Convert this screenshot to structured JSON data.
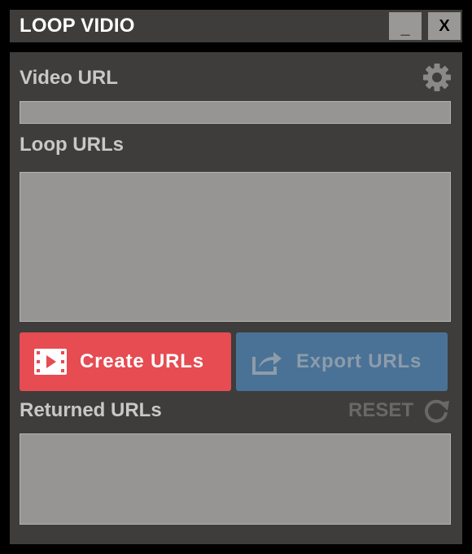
{
  "window": {
    "title": "LOOP VIDIO",
    "minimize_label": "_",
    "close_label": "X"
  },
  "video_url": {
    "label": "Video URL",
    "value": "",
    "placeholder": ""
  },
  "loop_urls": {
    "label": "Loop URLs",
    "value": "",
    "placeholder": ""
  },
  "actions": {
    "create_label": "Create URLs",
    "export_label": "Export URLs"
  },
  "returned_urls": {
    "label": "Returned URLs",
    "reset_label": "RESET",
    "value": "",
    "placeholder": ""
  },
  "icons": {
    "settings": "gear-icon",
    "create": "film-play-icon",
    "export": "share-export-icon",
    "reset": "refresh-icon"
  },
  "colors": {
    "background": "#000000",
    "panel": "#3e3d3b",
    "field": "#979593",
    "create_button": "#e64c52",
    "export_button": "#4a7296",
    "label_text": "#c9c8c6"
  }
}
